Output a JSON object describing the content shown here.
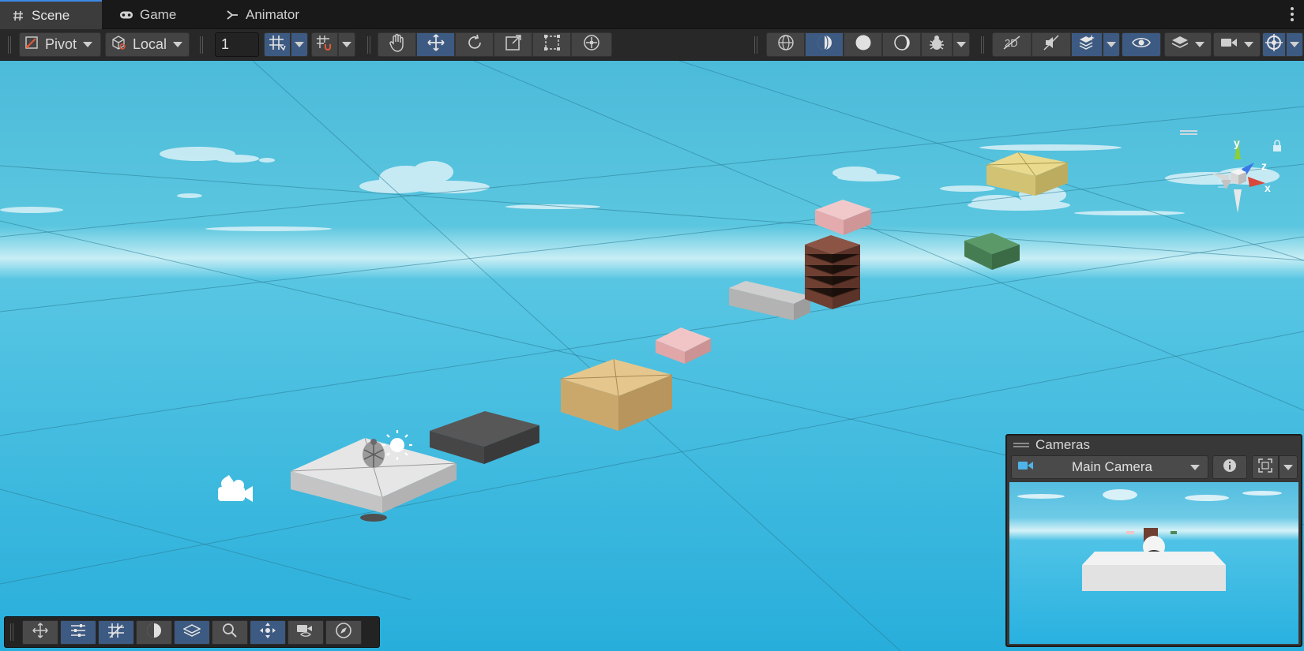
{
  "tabs": [
    {
      "label": "Scene",
      "icon": "hash-icon",
      "active": true
    },
    {
      "label": "Game",
      "icon": "gamepad-icon",
      "active": false
    },
    {
      "label": "Animator",
      "icon": "animator-icon",
      "active": false
    }
  ],
  "toolbar": {
    "pivot_label": "Pivot",
    "space_label": "Local",
    "grid_snap_value": "1"
  },
  "gizmo": {
    "y_label": "y",
    "z_label": "z",
    "x_label": "x"
  },
  "cameras": {
    "title": "Cameras",
    "selected_camera": "Main Camera"
  },
  "colors": {
    "accent": "#3d8ae6",
    "toggle_on": "#3d5a82",
    "sky": "#3cb4d8",
    "axis_x": "#d9483b",
    "axis_y": "#8ccf3a",
    "axis_z": "#3a78e6"
  }
}
